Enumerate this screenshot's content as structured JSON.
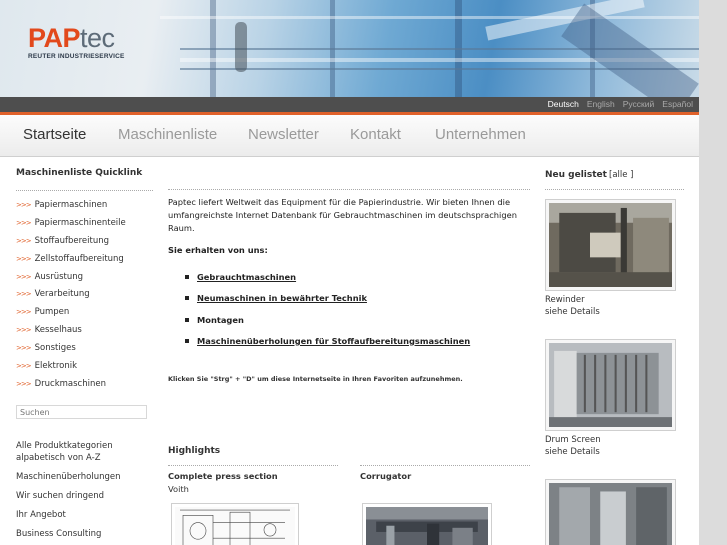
{
  "brand": {
    "name_part1": "PAP",
    "name_part2": "tec",
    "subtitle": "REUTER INDUSTRIESERVICE"
  },
  "languages": [
    {
      "label": "Deutsch",
      "active": true
    },
    {
      "label": "English",
      "active": false
    },
    {
      "label": "Русский",
      "active": false
    },
    {
      "label": "Español",
      "active": false
    }
  ],
  "nav": [
    "Startseite",
    "Maschinenliste",
    "Newsletter",
    "Kontakt",
    "Unternehmen"
  ],
  "quicklink": {
    "title": "Maschinenliste Quicklink",
    "items": [
      "Papiermaschinen",
      "Papiermaschinenteile",
      "Stoffaufbereitung",
      "Zellstoffaufbereitung",
      "Ausrüstung",
      "Verarbeitung",
      "Pumpen",
      "Kesselhaus",
      "Sonstiges",
      "Elektronik",
      "Druckmaschinen"
    ]
  },
  "search": {
    "placeholder": "Suchen"
  },
  "left_links": [
    "Alle Produktkategorien alpabetisch von A-Z",
    "Maschinenüberholungen",
    "Wir suchen dringend",
    "Ihr Angebot",
    "Business Consulting"
  ],
  "main": {
    "intro": "Paptec liefert Weltweit das Equipment für die Papierindustrie. Wir bieten Ihnen die umfangreichste Internet Datenbank für Gebrauchtmaschinen im deutschsprachigen Raum.",
    "subhead": "Sie erhalten von uns:",
    "bullets": [
      {
        "text": "Gebrauchtmaschinen",
        "link": true
      },
      {
        "text": "Neumaschinen in bewährter Technik",
        "link": true
      },
      {
        "text": "Montagen",
        "link": false
      },
      {
        "text": "Maschinenüberholungen für Stoffaufbereitungsmaschinen",
        "link": true
      }
    ],
    "tip": "Klicken Sie \"Strg\" + \"D\" um diese Internetseite in Ihren Favoriten aufzunehmen."
  },
  "highlights": {
    "title": "Highlights",
    "items": [
      {
        "title": "Complete press section",
        "subtitle": "Voith"
      },
      {
        "title": "Corrugator",
        "subtitle": ""
      }
    ]
  },
  "new_listed": {
    "title": "Neu gelistet",
    "all_link": "[alle ]",
    "items": [
      {
        "name": "Rewinder",
        "details": "siehe Details"
      },
      {
        "name": "Drum Screen",
        "details": "siehe Details"
      }
    ]
  },
  "colors": {
    "accent": "#e0612a",
    "brand_orange": "#e2491c",
    "langbar": "#4e4e4e"
  }
}
